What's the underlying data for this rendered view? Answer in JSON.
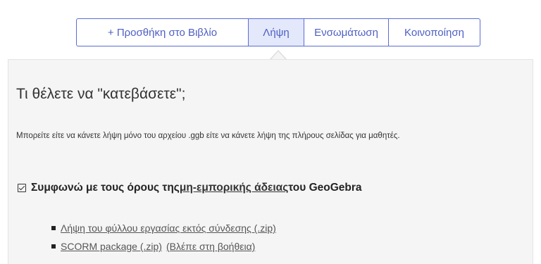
{
  "tabs": [
    {
      "label": "+ Προσθήκη στο Βιβλίο",
      "active": false
    },
    {
      "label": "Λήψη",
      "active": true
    },
    {
      "label": "Ενσωμάτωση",
      "active": false
    },
    {
      "label": "Κοινοποίηση",
      "active": false
    }
  ],
  "download": {
    "heading": "Τι θέλετε να \"κατεβάσετε\";",
    "description": "Μπορείτε είτε να κάνετε λήψη μόνο του αρχείου .ggb είτε να κάνετε λήψη της πλήρους σελίδας για μαθητές.",
    "agree": {
      "checked": true,
      "prefix": "Συμφωνώ με τους όρους της ",
      "link": "μη-εμπορικής άδειας",
      "suffix": " του GeoGebra"
    },
    "links": {
      "offline": "Λήψη του φύλλου εργασίας εκτός σύνδεσης (.zip)",
      "scorm": "SCORM package (.zip)",
      "help": "(Βλέπε στη βοήθεια)"
    }
  },
  "colors": {
    "accent": "#4d5fc4",
    "active_tab_bg": "#e4e8fb",
    "panel_bg": "#f5f5f5"
  }
}
